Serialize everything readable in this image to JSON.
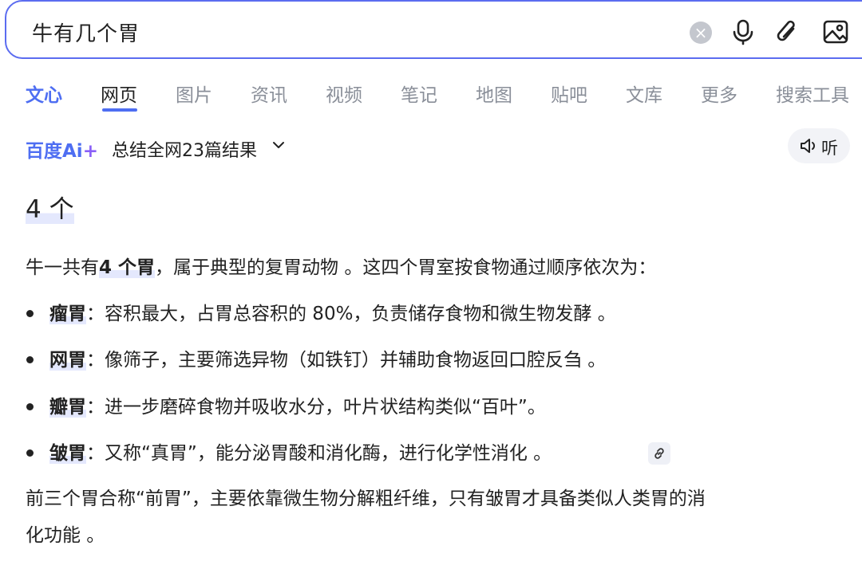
{
  "search": {
    "query": "牛有几个胃",
    "clear_icon": "close-circle-icon",
    "tools": [
      "microphone-icon",
      "paperclip-icon",
      "image-icon"
    ]
  },
  "tabs": [
    {
      "label": "文心"
    },
    {
      "label": "网页"
    },
    {
      "label": "图片"
    },
    {
      "label": "资讯"
    },
    {
      "label": "视频"
    },
    {
      "label": "笔记"
    },
    {
      "label": "地图"
    },
    {
      "label": "贴吧"
    },
    {
      "label": "文库"
    },
    {
      "label": "更多"
    },
    {
      "label": "搜索工具"
    }
  ],
  "ai_bar": {
    "logo_text": "百度Ai",
    "logo_plus": "+",
    "summary": "总结全网23篇结果",
    "listen_label": "听"
  },
  "answer": {
    "title_num": "4",
    "title_unit": "个",
    "intro_a": "牛一共有",
    "intro_b": "4 个胃",
    "intro_c": "，属于典型的复胃动物 。这四个胃室按食物通过顺序依次为：",
    "items": [
      {
        "term": "瘤胃",
        "desc": "：容积最大，占胃总容积的 80%，负责储存食物和微生物发酵 。"
      },
      {
        "term": "网胃",
        "desc": "：像筛子，主要筛选异物（如铁钉）并辅助食物返回口腔反刍 。"
      },
      {
        "term": "瓣胃",
        "desc": "：进一步磨碎食物并吸收水分，叶片状结构类似“百叶”。"
      },
      {
        "term": "皱胃",
        "desc": "：又称“真胃”，能分泌胃酸和消化酶，进行化学性消化 。"
      }
    ],
    "outro_line1": "前三个胃合称“前胃”，主要依靠微生物分解粗纤维，只有皱胃才具备类似人类胃的消",
    "outro_line2": "化功能 。"
  },
  "colors": {
    "accent": "#4e6ef2",
    "ai_purple": "#8a60f7",
    "muted": "#8a8f99"
  }
}
